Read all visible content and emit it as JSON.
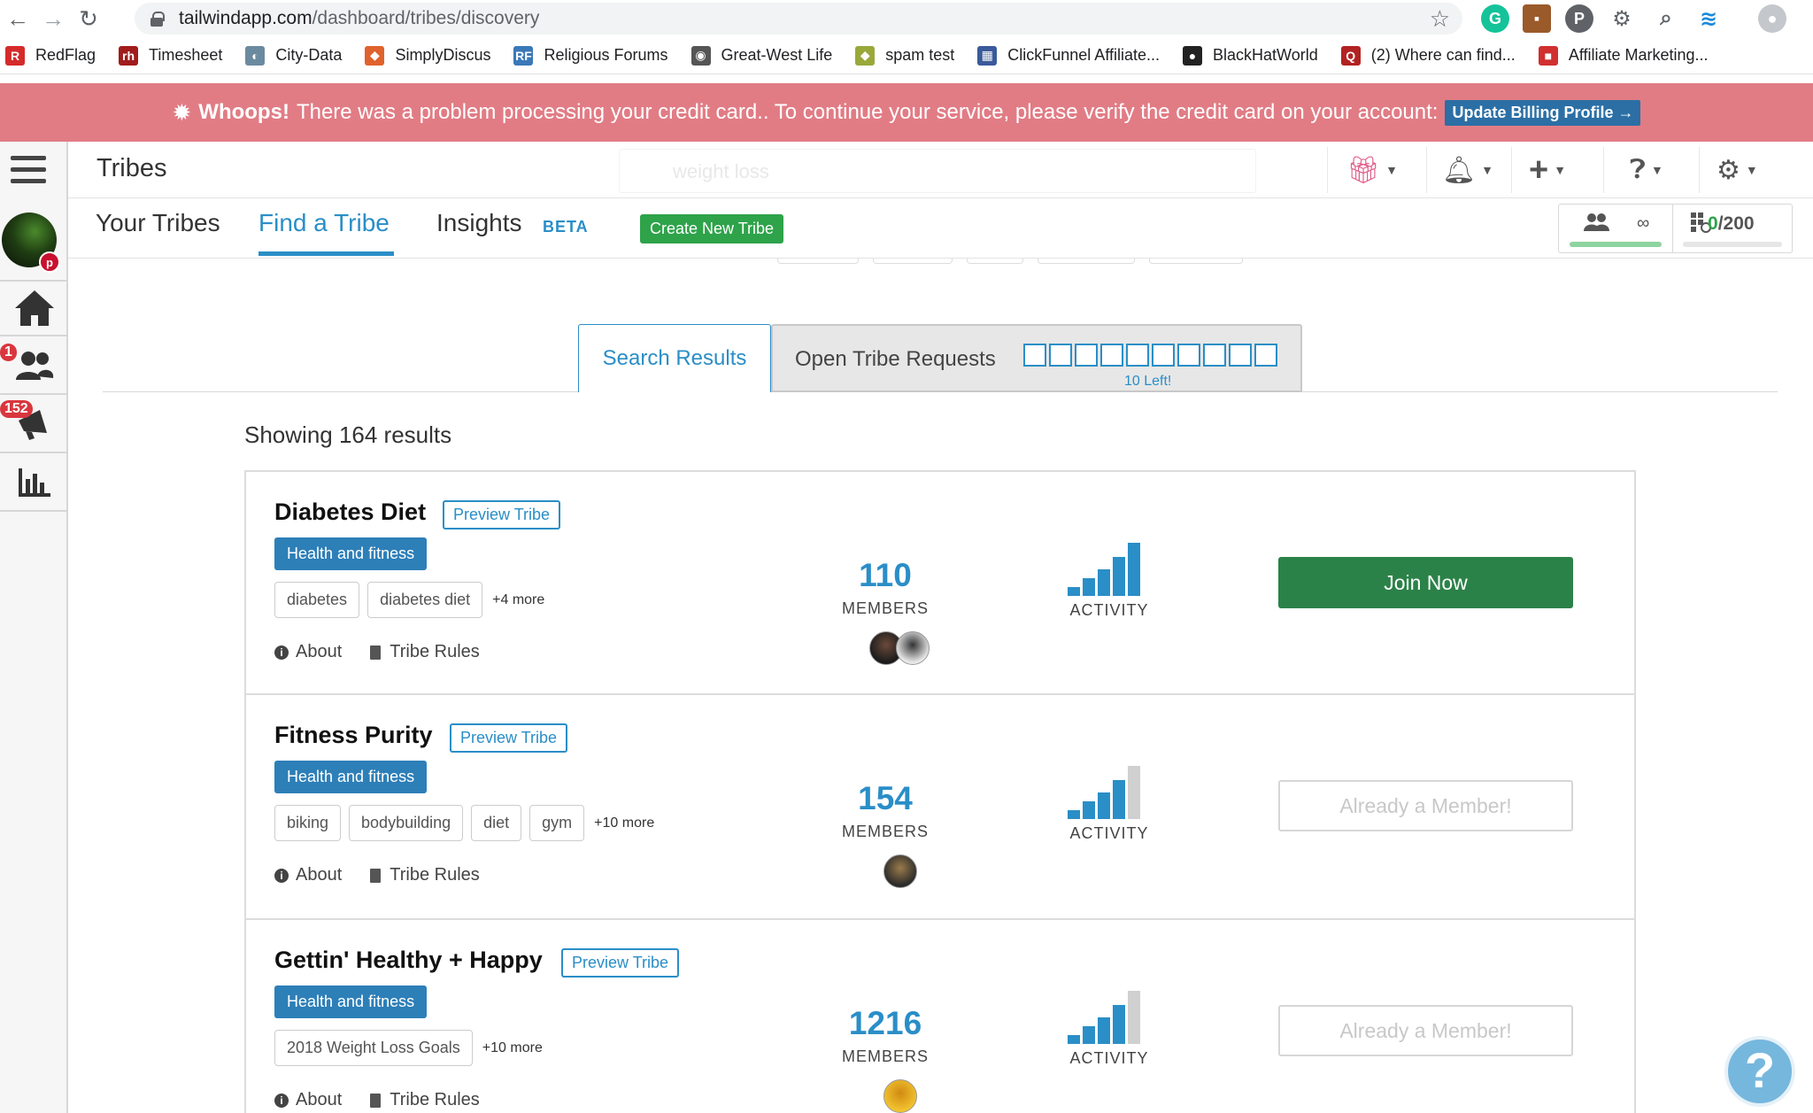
{
  "browser": {
    "url_host": "tailwindapp.com",
    "url_path": "/dashboard/tribes/discovery",
    "bookmarks": [
      {
        "label": "RedFlag",
        "color": "#d52a2a",
        "glyph": "R"
      },
      {
        "label": "Timesheet",
        "color": "#a11c1c",
        "glyph": "rh"
      },
      {
        "label": "City-Data",
        "color": "#6b8aa0",
        "glyph": "◐"
      },
      {
        "label": "SimplyDiscus",
        "color": "#e0622d",
        "glyph": "◆"
      },
      {
        "label": "Religious Forums",
        "color": "#3a78b8",
        "glyph": "RF"
      },
      {
        "label": "Great-West Life",
        "color": "#555555",
        "glyph": "◉"
      },
      {
        "label": "spam test",
        "color": "#9aa83a",
        "glyph": "◆"
      },
      {
        "label": "ClickFunnel Affiliate...",
        "color": "#3a5a9a",
        "glyph": "▦"
      },
      {
        "label": "BlackHatWorld",
        "color": "#222222",
        "glyph": "●"
      },
      {
        "label": "(2) Where can find...",
        "color": "#b22222",
        "glyph": "Q"
      },
      {
        "label": "Affiliate Marketing...",
        "color": "#d0302f",
        "glyph": "■"
      }
    ]
  },
  "alert": {
    "strong": "Whoops!",
    "message": "There was a problem processing your credit card.. To continue your service, please verify the credit card on your account:",
    "button": "Update Billing Profile →"
  },
  "rail": {
    "tribes_badge": "1",
    "campaigns_badge": "152"
  },
  "header": {
    "title": "Tribes",
    "search_placeholder": "weight loss"
  },
  "subnav": {
    "tabs": [
      "Your Tribes",
      "Find a Tribe",
      "Insights"
    ],
    "beta": "BETA",
    "create_button": "Create New Tribe",
    "quota_tribes": "∞",
    "quota_used": "0",
    "quota_total": "/200"
  },
  "results": {
    "tab_search": "Search Results",
    "tab_open": "Open Tribe Requests",
    "slots_left": "10 Left!",
    "showing": "Showing 164 results"
  },
  "tribes": [
    {
      "name": "Diabetes Diet",
      "preview": "Preview Tribe",
      "category": "Health and fitness",
      "tags": [
        "diabetes",
        "diabetes diet"
      ],
      "more": "+4 more",
      "about": "About",
      "rules": "Tribe Rules",
      "members": "110",
      "members_label": "MEMBERS",
      "activity_label": "ACTIVITY",
      "activity_level": 5,
      "action": "Join Now"
    },
    {
      "name": "Fitness Purity",
      "preview": "Preview Tribe",
      "category": "Health and fitness",
      "tags": [
        "biking",
        "bodybuilding",
        "diet",
        "gym"
      ],
      "more": "+10 more",
      "about": "About",
      "rules": "Tribe Rules",
      "members": "154",
      "members_label": "MEMBERS",
      "activity_label": "ACTIVITY",
      "activity_level": 4,
      "action": "Already a Member!"
    },
    {
      "name": "Gettin' Healthy + Happy",
      "preview": "Preview Tribe",
      "category": "Health and fitness",
      "tags": [
        "2018 Weight Loss Goals"
      ],
      "more": "+10 more",
      "about": "About",
      "rules": "Tribe Rules",
      "members": "1216",
      "members_label": "MEMBERS",
      "activity_label": "ACTIVITY",
      "activity_level": 4,
      "action": "Already a Member!"
    }
  ],
  "colors": {
    "accent_blue": "#2a8ec7",
    "join_green": "#2b8248",
    "alert_pink": "#e17c85",
    "create_green": "#2ea34a"
  }
}
